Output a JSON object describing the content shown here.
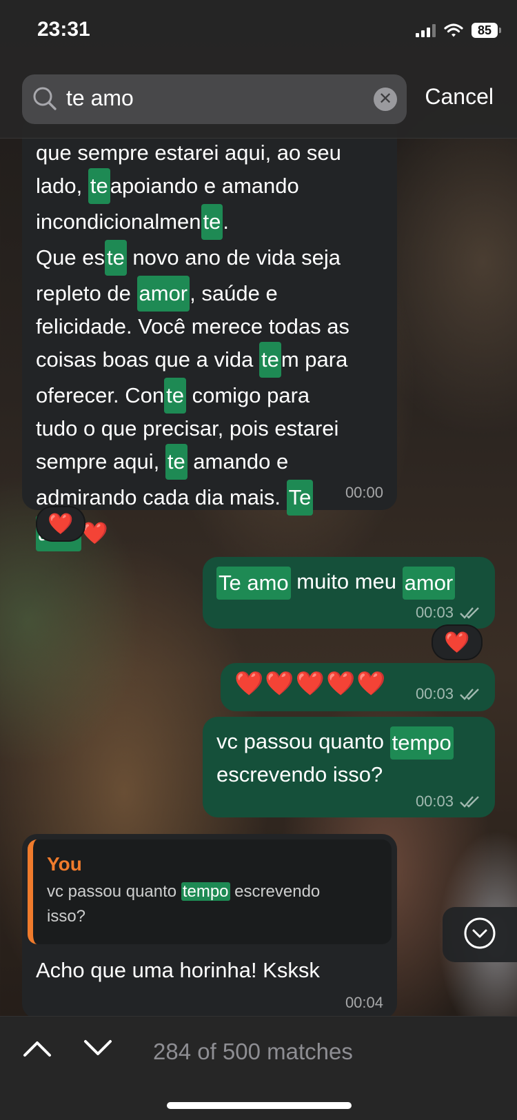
{
  "status_bar": {
    "time": "23:31",
    "battery": "85"
  },
  "search": {
    "query": "te amo",
    "clear_icon": "✕",
    "cancel_label": "Cancel"
  },
  "messages": {
    "m1": {
      "l1": "que sempre estarei aqui, ao seu",
      "l2a": "lado, ",
      "l2h": "te",
      "l2b": "apoiando e amando",
      "l3a": "incondicionalmen",
      "l3h": "te",
      "l3b": ".",
      "l4a": " Que es",
      "l4h": "te",
      "l4b": " novo ano de vida seja",
      "l5a": "repleto de ",
      "l5h": "amor",
      "l5b": ", saúde e",
      "l6": "felicidade. Você merece todas as",
      "l7a": "coisas boas que a vida ",
      "l7h": "te",
      "l7b": "m para",
      "l8a": "oferecer. Con",
      "l8h": "te",
      "l8b": " comigo para",
      "l9": "tudo o que precisar, pois estarei",
      "l10a": "sempre aqui, ",
      "l10h": "te",
      "l10b": " amando e",
      "l11a": "admirando cada dia mais. ",
      "l11h": "Te",
      "l12h": "amo",
      "l12b": "❤️",
      "time": "00:00",
      "reaction": "❤️"
    },
    "m2": {
      "h1": "Te amo",
      "t1": " muito meu ",
      "h2": "amor",
      "time": "00:03",
      "reaction": "❤️"
    },
    "m3": {
      "text": "❤️❤️❤️❤️❤️",
      "time": "00:03"
    },
    "m4": {
      "t1": "vc passou quanto ",
      "h1": "tempo",
      "t2": "escrevendo isso?",
      "time": "00:03"
    },
    "m5": {
      "quote_author": "You",
      "quote_t1": "vc passou quanto ",
      "quote_h1": "tempo",
      "quote_t2": " escrevendo",
      "quote_t3": "isso?",
      "text": "Acho que uma horinha! Ksksk",
      "time": "00:04"
    }
  },
  "bottom_bar": {
    "matches": "284 of 500 matches"
  },
  "colors": {
    "highlight": "#1e8a54",
    "incoming": "#222426",
    "outgoing": "#15503a",
    "quote_accent": "#f07b2c"
  }
}
